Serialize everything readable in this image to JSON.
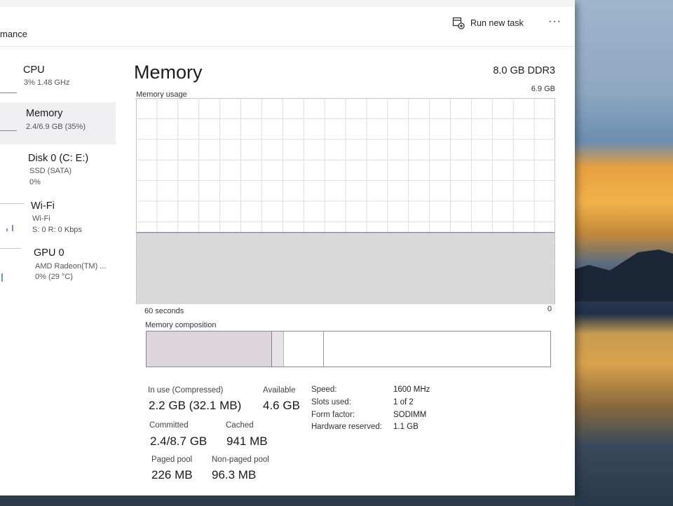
{
  "header": {
    "title": "mance",
    "run_task_label": "Run new task",
    "run_task_icon": "run-task-icon",
    "more_label": "···"
  },
  "sidebar": {
    "items": [
      {
        "name": "CPU",
        "line1": "3% 1.48 GHz",
        "line2": ""
      },
      {
        "name": "Memory",
        "line1": "2.4/6.9 GB (35%)",
        "line2": ""
      },
      {
        "name": "Disk 0 (C: E:)",
        "line1": "SSD (SATA)",
        "line2": "0%"
      },
      {
        "name": "Wi-Fi",
        "line1": "Wi-Fi",
        "line2": "S: 0 R: 0 Kbps"
      },
      {
        "name": "GPU 0",
        "line1": "AMD Radeon(TM) ...",
        "line2": "0% (29 °C)"
      }
    ]
  },
  "main": {
    "title": "Memory",
    "spec": "8.0 GB DDR3",
    "usage_label": "Memory usage",
    "usage_max": "6.9 GB",
    "axis_left": "60 seconds",
    "axis_right": "0",
    "composition_label": "Memory composition",
    "composition": {
      "in_use_fraction": 0.31,
      "modified_fraction": 0.03,
      "standby_fraction": 0.1
    }
  },
  "stats": {
    "in_use_label": "In use (Compressed)",
    "in_use_value": "2.2 GB (32.1 MB)",
    "available_label": "Available",
    "available_value": "4.6 GB",
    "committed_label": "Committed",
    "committed_value": "2.4/8.7 GB",
    "cached_label": "Cached",
    "cached_value": "941 MB",
    "paged_label": "Paged pool",
    "paged_value": "226 MB",
    "nonpaged_label": "Non-paged pool",
    "nonpaged_value": "96.3 MB"
  },
  "details": [
    {
      "label": "Speed:",
      "value": "1600 MHz"
    },
    {
      "label": "Slots used:",
      "value": "1 of 2"
    },
    {
      "label": "Form factor:",
      "value": "SODIMM"
    },
    {
      "label": "Hardware reserved:",
      "value": "1.1 GB"
    }
  ],
  "chart_data": {
    "type": "area",
    "title": "Memory usage",
    "xlabel": "60 seconds",
    "ylim": [
      0,
      6.9
    ],
    "y_unit": "GB",
    "x": [
      60,
      50,
      40,
      30,
      20,
      10,
      0
    ],
    "values": [
      2.4,
      2.4,
      2.4,
      2.4,
      2.4,
      2.4,
      2.4
    ],
    "grid": true,
    "colors": {
      "fill": "#d9d9d9",
      "line": "#8a6b9a",
      "grid": "#dedede"
    }
  }
}
